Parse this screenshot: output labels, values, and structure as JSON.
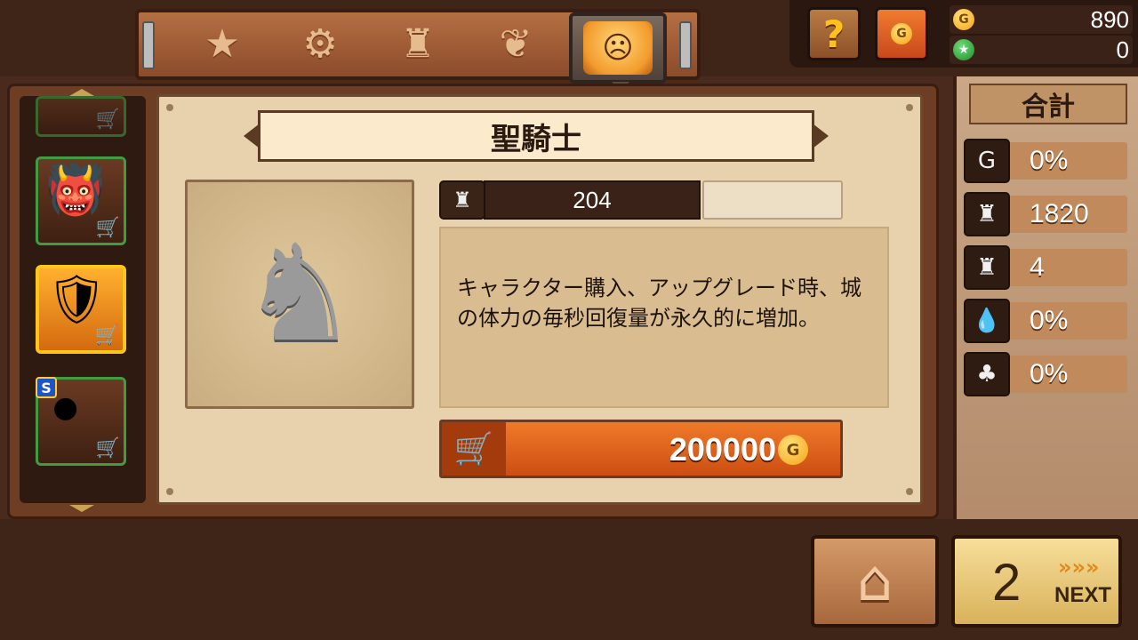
{
  "tabs": [
    {
      "icon": "star-icon",
      "glyph": "★"
    },
    {
      "icon": "cannon-icon",
      "glyph": "⚙"
    },
    {
      "icon": "castle-icon",
      "glyph": "♜"
    },
    {
      "icon": "scroll-icon",
      "glyph": "❦"
    },
    {
      "icon": "hero-face-icon",
      "glyph": "☹",
      "active": true
    }
  ],
  "wallet": {
    "help_glyph": "?",
    "cash_glyph": "G",
    "gold_coin_glyph": "G",
    "gold": "890",
    "star_glyph": "★",
    "stars": "0"
  },
  "carousel": {
    "s_badge": "S",
    "cart_glyph": "🛒",
    "items": [
      {
        "name": "samurai",
        "glyph": "👹"
      },
      {
        "name": "holy-knight",
        "glyph": "🛡"
      },
      {
        "name": "dark-knight",
        "glyph": "⚫"
      }
    ]
  },
  "character": {
    "name": "聖騎士",
    "portrait_glyph": "♞",
    "stat_glyph": "♜",
    "stat_value": "204",
    "description": "キャラクター購入、アップグレード時、城の体力の毎秒回復量が永久的に増加。",
    "price": "200000",
    "coin_glyph": "G",
    "cart_glyph": "🛒"
  },
  "summary": {
    "title": "合計",
    "rows": [
      {
        "icon": "gold-up-icon",
        "glyph": "G",
        "value": "0%"
      },
      {
        "icon": "castle-icon",
        "glyph": "♜",
        "value": "1820"
      },
      {
        "icon": "castle-heal-icon",
        "glyph": "♜",
        "value": "4"
      },
      {
        "icon": "drops-icon",
        "glyph": "💧",
        "value": "0%"
      },
      {
        "icon": "clover-icon",
        "glyph": "♣",
        "value": "0%"
      }
    ]
  },
  "nav": {
    "home_glyph": "⌂",
    "stage_number": "2",
    "next_arrows": "»»»",
    "next_label": "NEXT"
  }
}
